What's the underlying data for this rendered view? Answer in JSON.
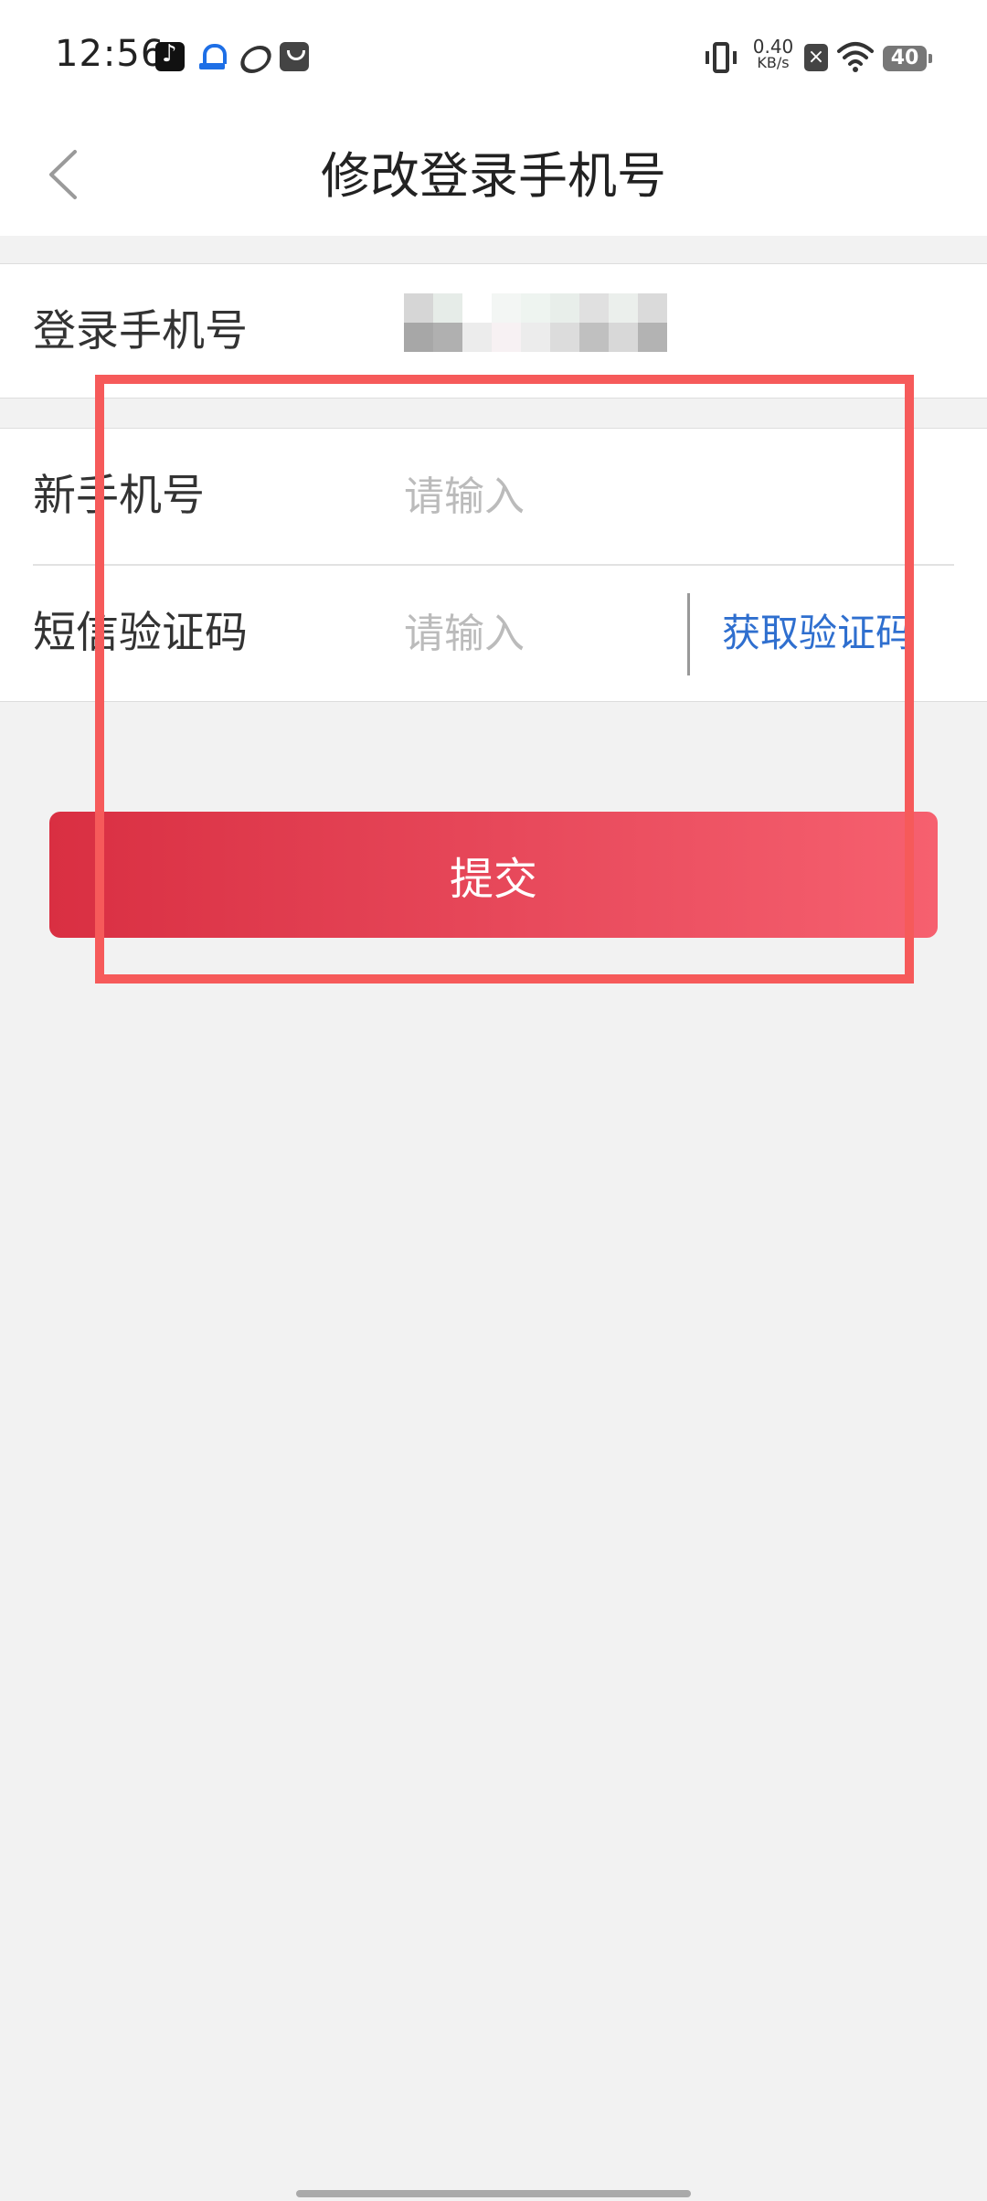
{
  "status_bar": {
    "time": "12:56",
    "net_speed_value": "0.40",
    "net_speed_unit": "KB/s",
    "battery": "40",
    "notification_icons": [
      "tiktok-icon",
      "app-icon",
      "app-icon",
      "app-icon"
    ],
    "right_icons": [
      "vibrate-icon",
      "close-icon",
      "wifi-icon",
      "battery-icon"
    ]
  },
  "header": {
    "title": "修改登录手机号",
    "back_icon": "chevron-left-icon"
  },
  "current_phone": {
    "label": "登录手机号"
  },
  "form": {
    "new_phone_label": "新手机号",
    "new_phone_placeholder": "请输入",
    "new_phone_value": "",
    "sms_code_label": "短信验证码",
    "sms_code_placeholder": "请输入",
    "sms_code_value": "",
    "get_code_label": "获取验证码"
  },
  "submit": {
    "label": "提交"
  },
  "colors": {
    "primary_start": "#d92f42",
    "primary_end": "#f6606f",
    "link": "#2f6fcf",
    "highlight": "#f65a5a"
  }
}
